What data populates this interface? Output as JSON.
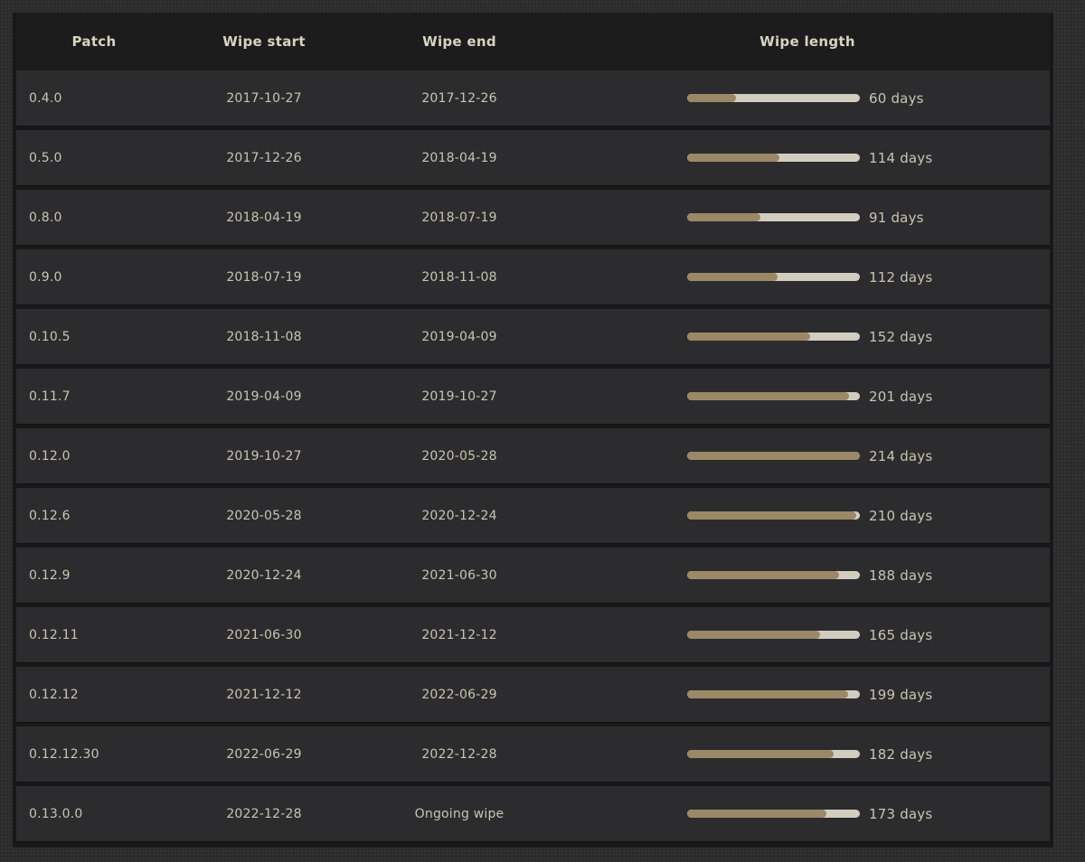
{
  "table": {
    "headers": {
      "patch": "Patch",
      "wipe_start": "Wipe start",
      "wipe_end": "Wipe end",
      "wipe_length": "Wipe length"
    },
    "max_days": 214,
    "rows": [
      {
        "patch": "0.4.0",
        "start": "2017-10-27",
        "end": "2017-12-26",
        "length": "60 days",
        "days": 60
      },
      {
        "patch": "0.5.0",
        "start": "2017-12-26",
        "end": "2018-04-19",
        "length": "114 days",
        "days": 114
      },
      {
        "patch": "0.8.0",
        "start": "2018-04-19",
        "end": "2018-07-19",
        "length": "91 days",
        "days": 91
      },
      {
        "patch": "0.9.0",
        "start": "2018-07-19",
        "end": "2018-11-08",
        "length": "112 days",
        "days": 112
      },
      {
        "patch": "0.10.5",
        "start": "2018-11-08",
        "end": "2019-04-09",
        "length": "152 days",
        "days": 152
      },
      {
        "patch": "0.11.7",
        "start": "2019-04-09",
        "end": "2019-10-27",
        "length": "201 days",
        "days": 201
      },
      {
        "patch": "0.12.0",
        "start": "2019-10-27",
        "end": "2020-05-28",
        "length": "214 days",
        "days": 214
      },
      {
        "patch": "0.12.6",
        "start": "2020-05-28",
        "end": "2020-12-24",
        "length": "210 days",
        "days": 210
      },
      {
        "patch": "0.12.9",
        "start": "2020-12-24",
        "end": "2021-06-30",
        "length": "188 days",
        "days": 188
      },
      {
        "patch": "0.12.11",
        "start": "2021-06-30",
        "end": "2021-12-12",
        "length": "165 days",
        "days": 165
      },
      {
        "patch": "0.12.12",
        "start": "2021-12-12",
        "end": "2022-06-29",
        "length": "199 days",
        "days": 199
      },
      {
        "patch": "0.12.12.30",
        "start": "2022-06-29",
        "end": "2022-12-28",
        "length": "182 days",
        "days": 182
      },
      {
        "patch": "0.13.0.0",
        "start": "2022-12-28",
        "end": "Ongoing wipe",
        "length": "173 days",
        "days": 173
      }
    ]
  },
  "colors": {
    "bar_fill": "#9b8866",
    "bar_track": "#d2cebf",
    "row_bg": "#2c2c2e",
    "header_bg": "#1c1c1c",
    "text": "#c9c4b2"
  }
}
